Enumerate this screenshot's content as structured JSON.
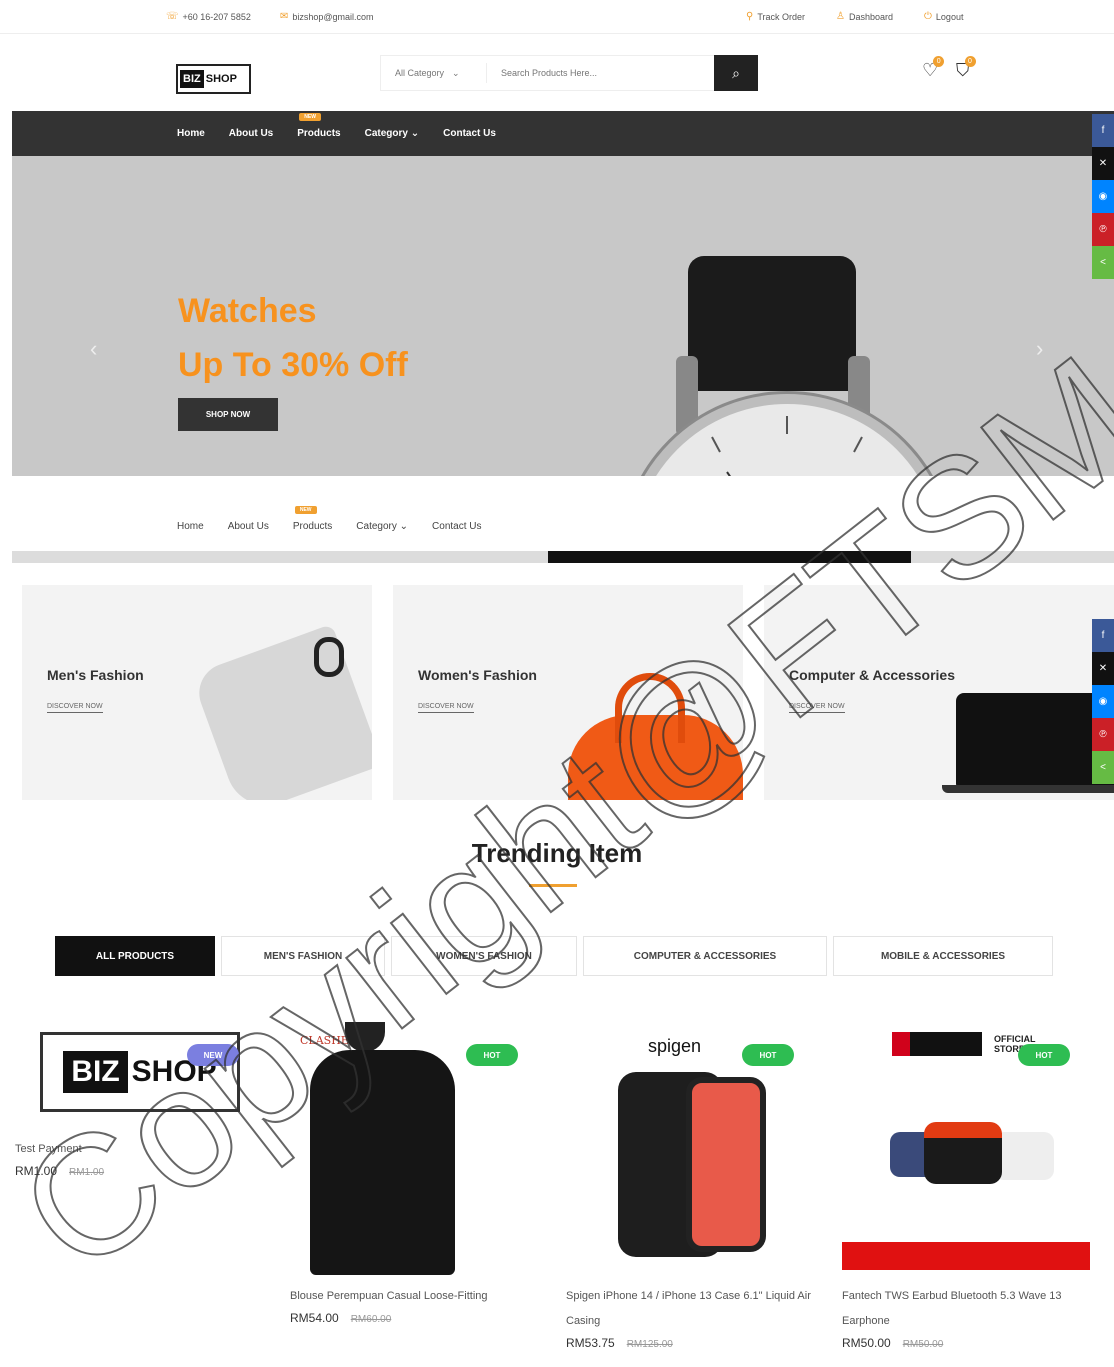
{
  "topbar": {
    "phone": "+60 16-207 5852",
    "email": "bizshop@gmail.com",
    "track_order": "Track Order",
    "dashboard": "Dashboard",
    "logout": "Logout"
  },
  "header": {
    "logo_biz": "BIZ",
    "logo_shop": "SHOP",
    "category_select": "All Category",
    "search_placeholder": "Search Products Here...",
    "wishlist_count": "0",
    "cart_count": "0"
  },
  "nav": {
    "home": "Home",
    "about": "About Us",
    "products": "Products",
    "products_tag": "NEW",
    "category": "Category",
    "contact": "Contact Us"
  },
  "hero": {
    "line1": "Watches",
    "line2": "Up To 30% Off",
    "button": "SHOP NOW",
    "prev": "‹",
    "next": "›"
  },
  "categories": [
    {
      "name": "Men's Fashion",
      "link": "DISCOVER NOW"
    },
    {
      "name": "Women's Fashion",
      "link": "DISCOVER NOW"
    },
    {
      "name": "Computer & Accessories",
      "link": "DISCOVER NOW"
    }
  ],
  "trending": {
    "title": "Trending Item",
    "tabs": [
      "ALL PRODUCTS",
      "MEN'S FASHION",
      "WOMEN'S FASHION",
      "COMPUTER & ACCESSORIES",
      "MOBILE & ACCESSORIES"
    ]
  },
  "products": [
    {
      "name": "Test Payment",
      "price": "RM1.00",
      "old_price": "RM1.00",
      "badge": "NEW",
      "logo_biz": "BIZ",
      "logo_shop": "SHOP"
    },
    {
      "name": "Blouse Perempuan Casual Loose-Fitting",
      "price": "RM54.00",
      "old_price": "RM60.00",
      "badge": "HOT",
      "brand": "CLASHE"
    },
    {
      "name": "Spigen iPhone 14 / iPhone 13 Case 6.1\" Liquid Air Casing",
      "price": "RM53.75",
      "old_price": "RM125.00",
      "badge": "HOT",
      "brand": "spigen"
    },
    {
      "name": "Fantech TWS Earbud Bluetooth 5.3 Wave 13 Earphone",
      "price": "RM50.00",
      "old_price": "RM50.00",
      "badge": "HOT",
      "brand": "OFFICIAL STORE"
    }
  ],
  "watermark": "Copyright@FTSM UKM",
  "colors": {
    "accent": "#f7921e",
    "dark": "#333333",
    "hot": "#2ebd52",
    "new": "#7b7fe0"
  }
}
